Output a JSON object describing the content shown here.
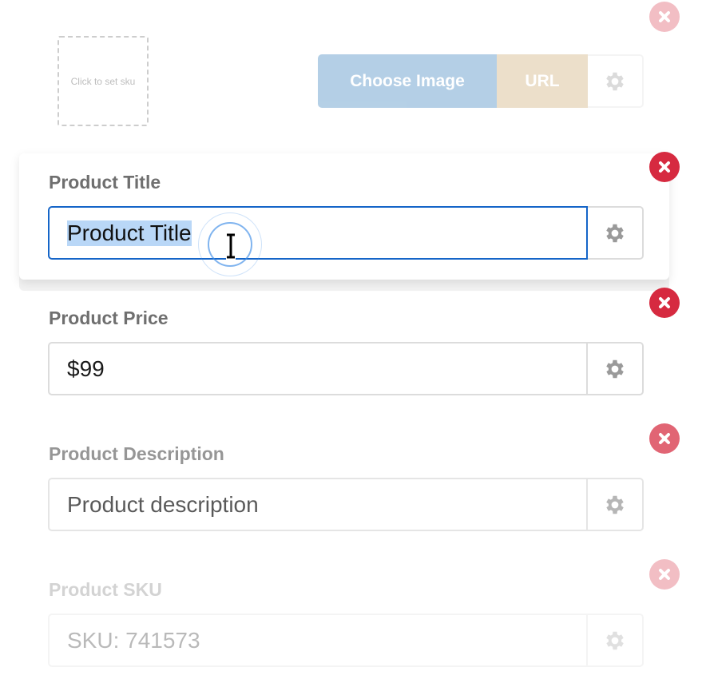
{
  "image_row": {
    "sku_placeholder": "Click to set sku",
    "choose_image_label": "Choose Image",
    "url_label": "URL",
    "settings_icon": "gear-icon",
    "remove_icon": "close-icon"
  },
  "fields": [
    {
      "label": "Product Title",
      "value": "Product Title",
      "state": "focused-selected",
      "settings_icon": "gear-icon",
      "remove_icon": "close-icon"
    },
    {
      "label": "Product Price",
      "value": "$99",
      "state": "normal",
      "settings_icon": "gear-icon",
      "remove_icon": "close-icon"
    },
    {
      "label": "Product Description",
      "value": "Product description",
      "state": "faded",
      "settings_icon": "gear-icon",
      "remove_icon": "close-icon"
    },
    {
      "label": "Product SKU",
      "value": "SKU: 741573",
      "state": "faded-more",
      "settings_icon": "gear-icon",
      "remove_icon": "close-icon"
    }
  ],
  "colors": {
    "remove_red": "#d62a40",
    "focus_blue": "#1565c8",
    "selection_blue": "#b9d7f7",
    "choose_image_blue": "#2a78b8",
    "url_tan": "#c9a66b"
  }
}
